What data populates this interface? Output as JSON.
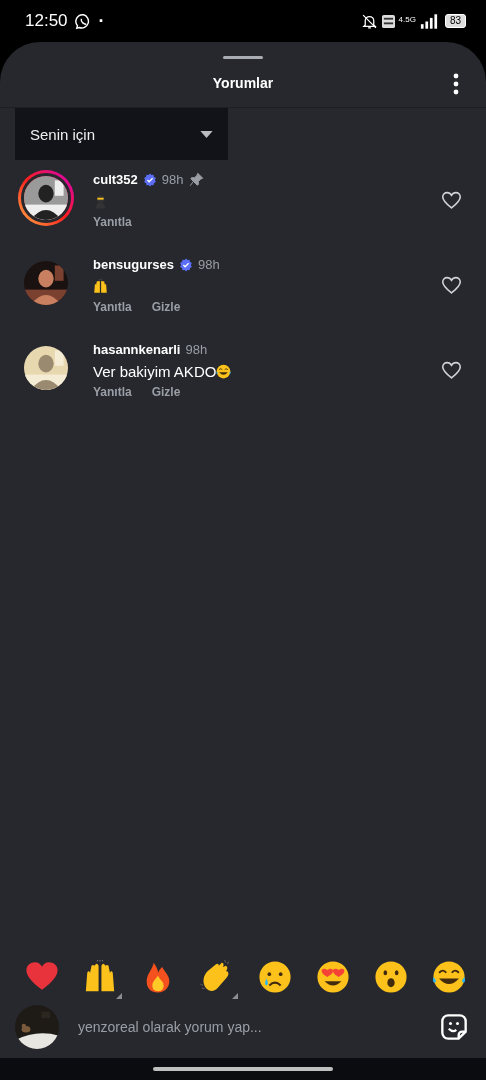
{
  "status_bar": {
    "time": "12:50",
    "dot": "·",
    "network": "4.5G",
    "battery": "83"
  },
  "sheet": {
    "title": "Yorumlar"
  },
  "sort_dropdown": {
    "value": "Senin için"
  },
  "comments": [
    {
      "username": "cult352",
      "verified": true,
      "time": "98h",
      "pinned": true,
      "has_story": true,
      "emoji": {
        "kind": "ninja"
      },
      "actions": [
        "Yanıtla"
      ],
      "liked": false
    },
    {
      "username": "bensugurses",
      "verified": true,
      "time": "98h",
      "pinned": false,
      "has_story": false,
      "emoji": {
        "kind": "raised-hands"
      },
      "actions": [
        "Yanıtla",
        "Gizle"
      ],
      "liked": false
    },
    {
      "username": "hasannkenarli",
      "verified": false,
      "time": "98h",
      "pinned": false,
      "has_story": false,
      "text": "Ver bakiyim AKDO",
      "emoji": {
        "kind": "laughing"
      },
      "actions": [
        "Yanıtla",
        "Gizle"
      ],
      "liked": false
    }
  ],
  "reactions": [
    {
      "kind": "heart",
      "variants": false
    },
    {
      "kind": "raised-hands",
      "variants": true
    },
    {
      "kind": "fire",
      "variants": false
    },
    {
      "kind": "clap",
      "variants": true
    },
    {
      "kind": "crying",
      "variants": false
    },
    {
      "kind": "heart-eyes",
      "variants": false
    },
    {
      "kind": "surprised",
      "variants": false
    },
    {
      "kind": "laughing",
      "variants": false
    }
  ],
  "composer": {
    "placeholder": "yenzoreal olarak yorum yap..."
  }
}
